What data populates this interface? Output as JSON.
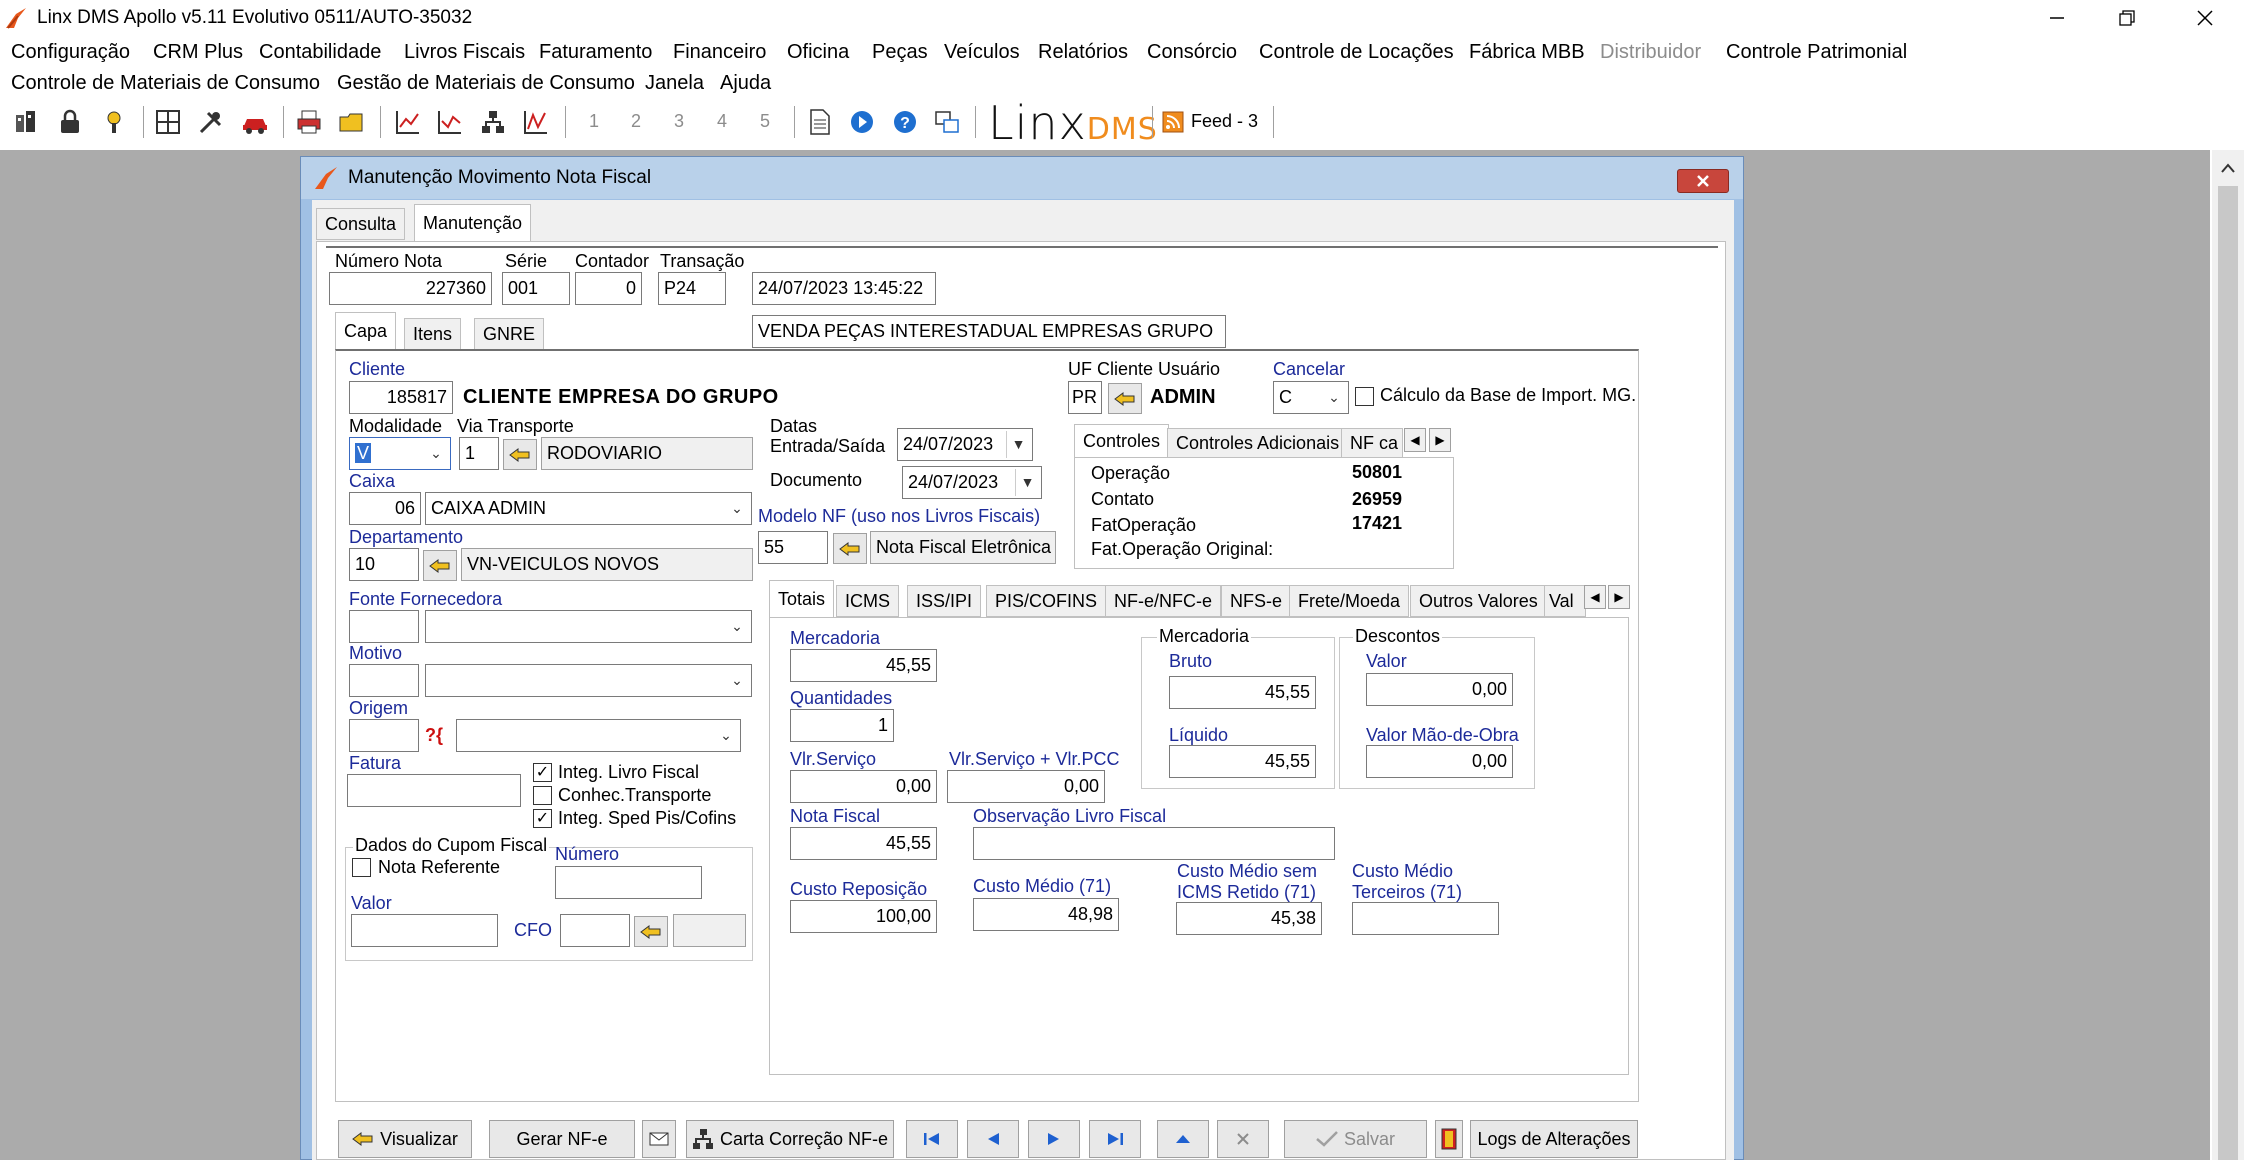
{
  "app": {
    "title": "Linx DMS Apollo v5.11 Evolutivo 0511/AUTO-35032"
  },
  "menu": {
    "row1": [
      "Configuração",
      "CRM Plus",
      "Contabilidade",
      "Livros Fiscais",
      "Faturamento",
      "Financeiro",
      "Oficina",
      "Peças",
      "Veículos",
      "Relatórios",
      "Consórcio",
      "Controle de Locações",
      "Fábrica MBB",
      "Distribuidor",
      "Controle Patrimonial"
    ],
    "row2": [
      "Controle de Materiais de Consumo",
      "Gestão de Materiais de Consumo",
      "Janela",
      "Ajuda"
    ]
  },
  "toolbar": {
    "numbers": [
      "1",
      "2",
      "3",
      "4",
      "5"
    ],
    "logo": "Linx",
    "logo_suffix": "DMS",
    "feed": "Feed - 3"
  },
  "dialog": {
    "title": "Manutenção Movimento Nota Fiscal",
    "tabs": [
      "Consulta",
      "Manutenção"
    ],
    "header": {
      "numero_nota_label": "Número Nota",
      "numero_nota": "227360",
      "serie_label": "Série",
      "serie": "001",
      "contador_label": "Contador",
      "contador": "0",
      "transacao_label": "Transação",
      "transacao": "P24",
      "datetime": "24/07/2023 13:45:22",
      "descricao": "VENDA PEÇAS INTERESTADUAL EMPRESAS GRUPO"
    },
    "subtabs": [
      "Capa",
      "Itens",
      "GNRE"
    ],
    "capa": {
      "cliente_label": "Cliente",
      "cliente_code": "185817",
      "cliente_name": "CLIENTE EMPRESA DO GRUPO",
      "uf_label": "UF Cliente Usuário",
      "uf": "PR",
      "usuario": "ADMIN",
      "cancelar_label": "Cancelar",
      "cancelar": "C",
      "calculo_label": "Cálculo da Base de Import. MG.",
      "modalidade_label": "Modalidade",
      "modalidade": "V",
      "via_transporte_label": "Via Transporte",
      "via_transporte": "1",
      "via_transporte_desc": "RODOVIARIO",
      "datas_label": "Datas",
      "entrada_saida_label": "Entrada/Saída",
      "entrada_saida": "24/07/2023",
      "documento_label": "Documento",
      "documento": "24/07/2023",
      "caixa_label": "Caixa",
      "caixa_code": "06",
      "caixa_desc": "CAIXA ADMIN",
      "modelo_nf_label": "Modelo NF (uso nos Livros Fiscais)",
      "modelo_nf": "55",
      "modelo_nf_desc": "Nota Fiscal Eletrônica",
      "departamento_label": "Departamento",
      "departamento_code": "10",
      "departamento_desc": "VN-VEICULOS NOVOS",
      "fonte_label": "Fonte Fornecedora",
      "motivo_label": "Motivo",
      "origem_label": "Origem",
      "origem_icon": "?{",
      "fatura_label": "Fatura",
      "integ_livro": "Integ. Livro Fiscal",
      "conhec": "Conhec.Transporte",
      "integ_sped": "Integ. Sped Pis/Cofins",
      "cupom_label": "Dados do Cupom Fiscal",
      "nota_referente": "Nota Referente",
      "numero_label": "Número",
      "valor_label": "Valor",
      "cfo_label": "CFO"
    },
    "controles": {
      "tabs": [
        "Controles",
        "Controles Adicionais",
        "NF ca"
      ],
      "rows": [
        {
          "label": "Operação",
          "value": "50801"
        },
        {
          "label": "Contato",
          "value": "26959"
        },
        {
          "label": "FatOperação",
          "value": "17421"
        },
        {
          "label": "Fat.Operação Original:",
          "value": ""
        }
      ]
    },
    "totais": {
      "tabs": [
        "Totais",
        "ICMS",
        "ISS/IPI",
        "PIS/COFINS",
        "NF-e/NFC-e",
        "NFS-e",
        "Frete/Moeda",
        "Outros Valores",
        "Val"
      ],
      "mercadoria_label": "Mercadoria",
      "mercadoria": "45,55",
      "quantidades_label": "Quantidades",
      "quantidades": "1",
      "vlr_servico_label": "Vlr.Serviço",
      "vlr_servico": "0,00",
      "vlr_servico_pcc_label": "Vlr.Serviço + Vlr.PCC",
      "vlr_servico_pcc": "0,00",
      "nota_fiscal_label": "Nota Fiscal",
      "nota_fiscal": "45,55",
      "obs_label": "Observação Livro Fiscal",
      "merc_group": "Mercadoria",
      "bruto_label": "Bruto",
      "bruto": "45,55",
      "liquido_label": "Líquido",
      "liquido": "45,55",
      "desc_group": "Descontos",
      "valor_label": "Valor",
      "valor": "0,00",
      "mao_obra_label": "Valor Mão-de-Obra",
      "mao_obra": "0,00",
      "custo_rep_label": "Custo Reposição",
      "custo_rep": "100,00",
      "custo_medio_label": "Custo Médio (71)",
      "custo_medio": "48,98",
      "custo_sem_icms_label1": "Custo Médio sem",
      "custo_sem_icms_label2": "ICMS Retido (71)",
      "custo_sem_icms": "45,38",
      "custo_terc_label1": "Custo Médio",
      "custo_terc_label2": "Terceiros (71)"
    },
    "buttons": {
      "visualizar": "Visualizar",
      "gerar": "Gerar NF-e",
      "carta": "Carta Correção NF-e",
      "salvar": "Salvar",
      "logs": "Logs de Alterações"
    }
  }
}
